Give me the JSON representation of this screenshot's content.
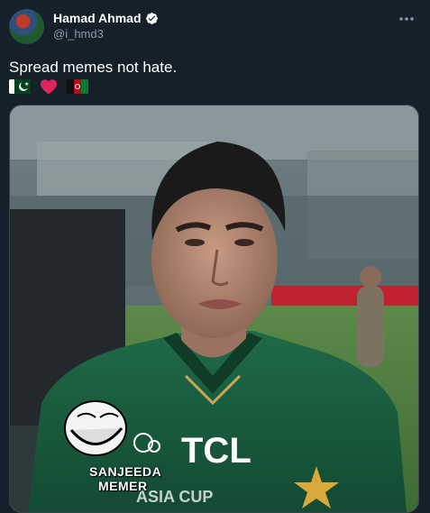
{
  "tweet": {
    "author": {
      "display_name": "Hamad Ahmad",
      "handle": "@i_hmd3",
      "verified": true
    },
    "text": "Spread memes not hate.",
    "emojis": [
      "flag-pakistan",
      "red-heart",
      "flag-afghanistan"
    ],
    "more_icon": "more-icon"
  },
  "media": {
    "type": "video-still",
    "jersey_sponsor": "TCL",
    "jersey_text": "ASIA CUP",
    "watermark": {
      "line1": "SANJEEDA",
      "line2": "MEMER"
    }
  },
  "colors": {
    "background": "#15202b",
    "secondary_text": "#8899a6",
    "verified_blue": "#ffffff",
    "heart_red": "#e0245e",
    "jersey_green": "#1b5b3f"
  }
}
